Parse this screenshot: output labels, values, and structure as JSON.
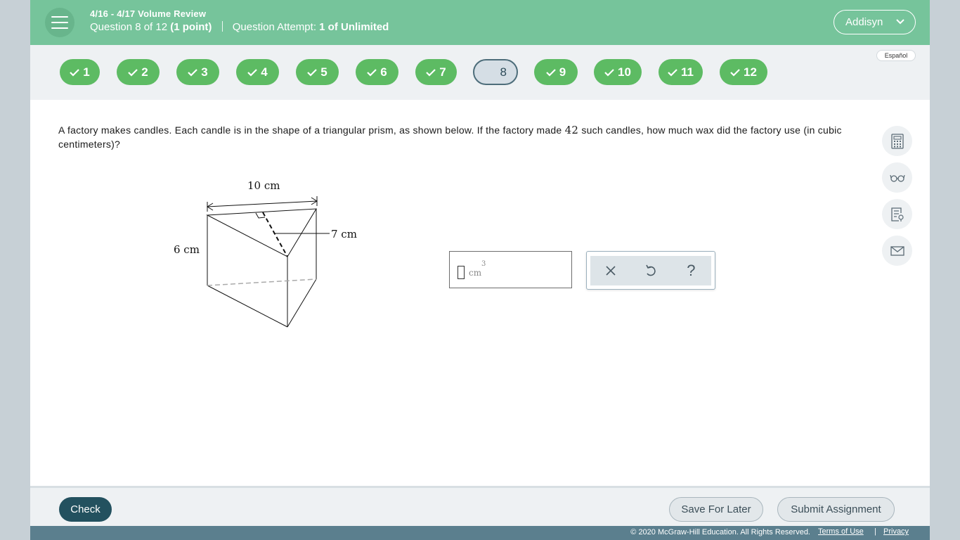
{
  "header": {
    "assignment_title": "4/16 - 4/17 Volume Review",
    "question_prefix": "Question 8 of 12",
    "question_points": "(1 point)",
    "attempt_label": "Question Attempt:",
    "attempt_value": "1 of Unlimited",
    "user_name": "Addisyn"
  },
  "question_nav": {
    "language_label": "Español",
    "questions": [
      {
        "label": "1",
        "status": "correct"
      },
      {
        "label": "2",
        "status": "correct"
      },
      {
        "label": "3",
        "status": "correct"
      },
      {
        "label": "4",
        "status": "correct"
      },
      {
        "label": "5",
        "status": "correct"
      },
      {
        "label": "6",
        "status": "correct"
      },
      {
        "label": "7",
        "status": "correct"
      },
      {
        "label": "8",
        "status": "current"
      },
      {
        "label": "9",
        "status": "correct"
      },
      {
        "label": "10",
        "status": "correct"
      },
      {
        "label": "11",
        "status": "correct"
      },
      {
        "label": "12",
        "status": "correct"
      }
    ]
  },
  "question": {
    "text_before": "A factory makes candles. Each candle is in the shape of a triangular prism, as shown below. If the factory made ",
    "count": "42",
    "text_after": " such candles, how much wax did the factory use (in cubic centimeters)?"
  },
  "figure": {
    "top_label": "10 cm",
    "right_label": "7 cm",
    "left_label": "6 cm"
  },
  "answer": {
    "value": "",
    "unit": "cm",
    "unit_exponent": "3"
  },
  "answer_tools": {
    "clear_icon": "close-icon",
    "undo_icon": "undo-icon",
    "help_label": "?"
  },
  "side_tools": [
    "calculator-icon",
    "glasses-icon",
    "notes-icon",
    "mail-icon"
  ],
  "footer": {
    "check_label": "Check",
    "save_label": "Save For Later",
    "submit_label": "Submit Assignment"
  },
  "legal": {
    "copyright": "© 2020 McGraw-Hill Education. All Rights Reserved.",
    "terms": "Terms of Use",
    "separator": "|",
    "privacy": "Privacy"
  },
  "colors": {
    "header_bg": "#76c49b",
    "correct_badge": "#5dbb63",
    "current_badge_border": "#4d6d7a",
    "primary_button": "#23515f",
    "legal_bar": "#5b7f8e"
  }
}
